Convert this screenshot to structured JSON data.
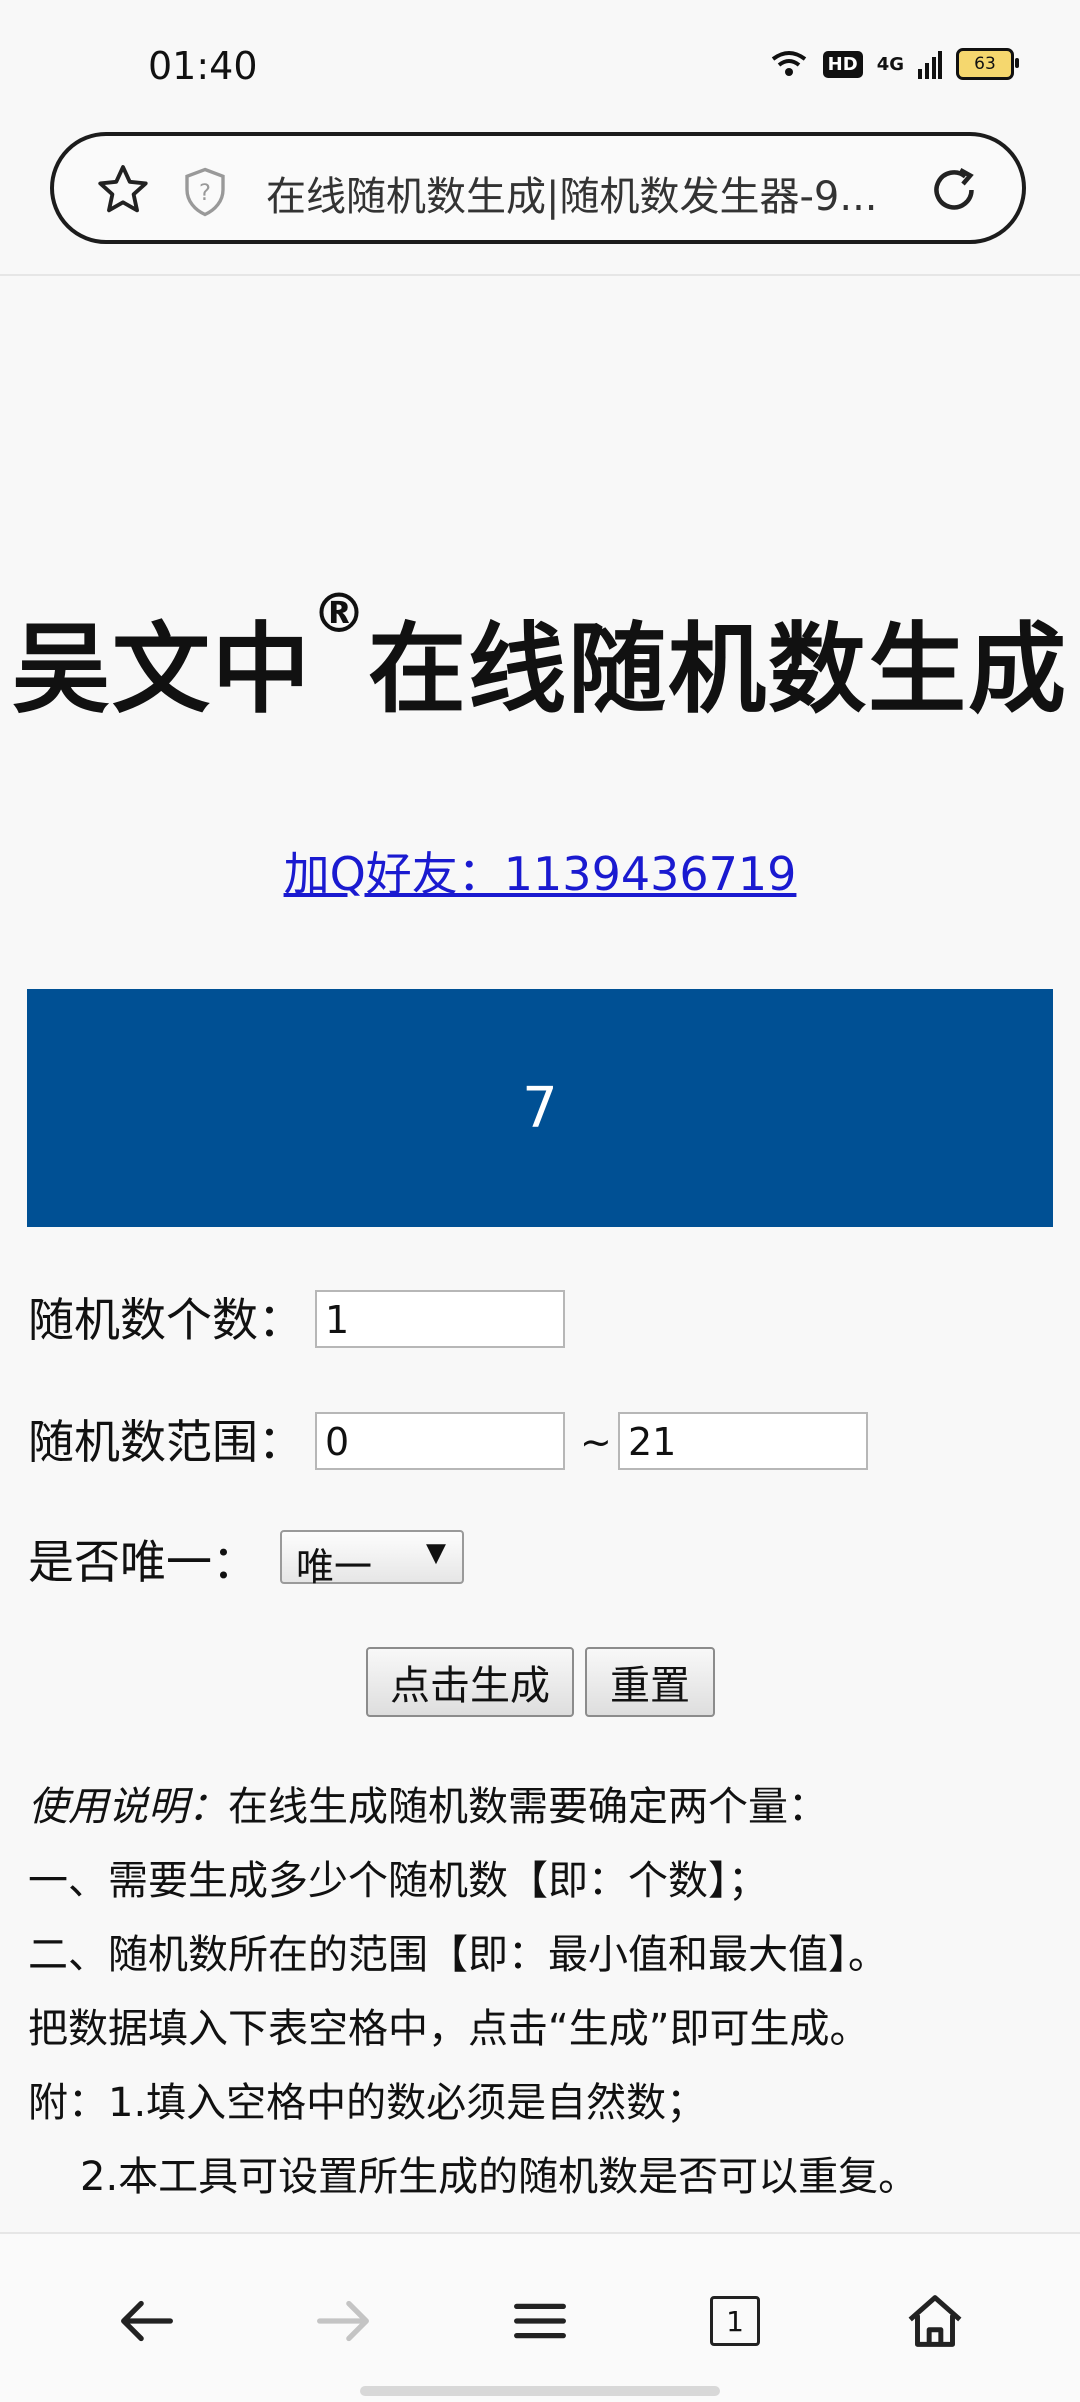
{
  "status_bar": {
    "time": "01:40",
    "hd_label": "HD",
    "network_label": "4G",
    "battery_level": "63"
  },
  "browser": {
    "page_title": "在线随机数生成|随机数发生器-9...",
    "icons": [
      "star-icon",
      "shield-question-icon",
      "reload-icon"
    ]
  },
  "page": {
    "heading": "吴文中",
    "heading_registered": "®",
    "heading_rest": "在线随机数生成",
    "qq_link": "加Q好友：1139436719",
    "result": "7",
    "count_label": "随机数个数：",
    "count_value": "1",
    "range_label": "随机数范围：",
    "range_min": "0",
    "range_separator": "~",
    "range_max": "21",
    "unique_label": "是否唯一：",
    "unique_selected": "唯一",
    "generate_button": "点击生成",
    "reset_button": "重置",
    "notes": {
      "intro_em": "使用说明：",
      "intro_text": "在线生成随机数需要确定两个量：",
      "line1": "一、需要生成多少个随机数【即：个数】；",
      "line2": "二、随机数所在的范围【即：最小值和最大值】。",
      "line3": "把数据填入下表空格中，点击“生成”即可生成。",
      "line4": "附：1.填入空格中的数必须是自然数；",
      "line5": "2.本工具可设置所生成的随机数是否可以重复。"
    }
  },
  "bottom_nav": {
    "tab_count": "1",
    "icons": [
      "back-arrow-icon",
      "forward-arrow-icon",
      "menu-icon",
      "tabs-icon",
      "home-icon"
    ]
  }
}
